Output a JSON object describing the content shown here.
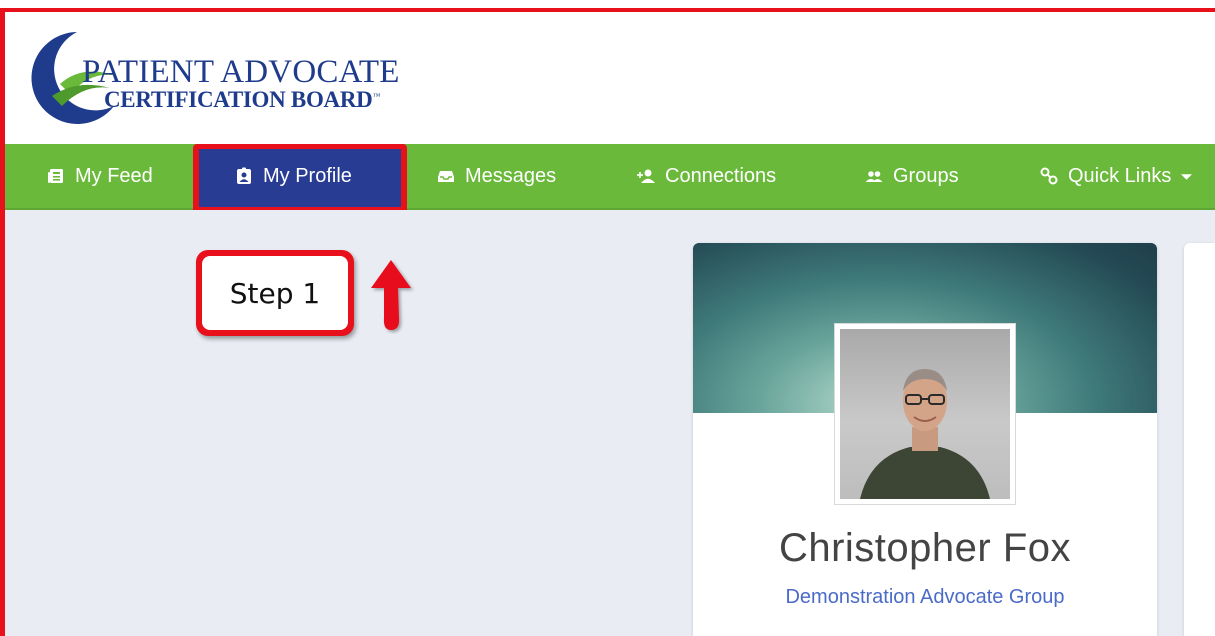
{
  "logo": {
    "line1": "PATIENT ADVOCATE",
    "line2": "CERTIFICATION BOARD",
    "tm": "™"
  },
  "nav": {
    "items": [
      {
        "label": "My Feed",
        "icon": "newspaper-icon"
      },
      {
        "label": "My Profile",
        "icon": "id-badge-icon",
        "active": true
      },
      {
        "label": "Messages",
        "icon": "inbox-icon"
      },
      {
        "label": "Connections",
        "icon": "add-person-icon"
      },
      {
        "label": "Groups",
        "icon": "people-icon"
      },
      {
        "label": "Quick Links",
        "icon": "link-icon",
        "dropdown": true
      }
    ]
  },
  "callout": {
    "label": "Step 1"
  },
  "profile": {
    "name": "Christopher Fox",
    "group": "Demonstration Advocate Group"
  },
  "colors": {
    "nav_green": "#6ab93a",
    "active_blue": "#283c93",
    "annotation_red": "#e8101b",
    "brand_blue": "#1f3b8c",
    "link_blue": "#4a6bc8"
  }
}
